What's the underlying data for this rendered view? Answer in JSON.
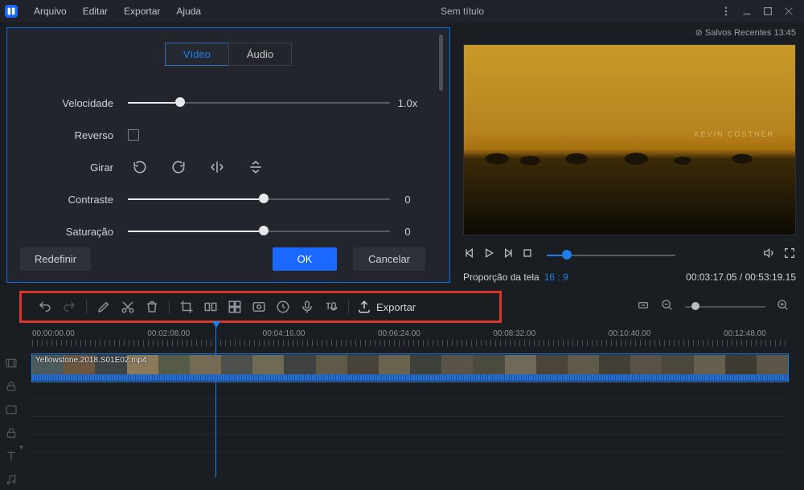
{
  "menu": {
    "file": "Arquivo",
    "edit": "Editar",
    "export": "Exportar",
    "help": "Ajuda"
  },
  "title": "Sem título",
  "save_status": "⊘ Salvos Recentes 13:45",
  "tabs": {
    "video": "Vídeo",
    "audio": "Áudio"
  },
  "props": {
    "speed_label": "Velocidade",
    "speed_value": "1.0x",
    "reverse_label": "Reverso",
    "rotate_label": "Girar",
    "contrast_label": "Contraste",
    "contrast_value": "0",
    "saturation_label": "Saturação",
    "saturation_value": "0"
  },
  "buttons": {
    "reset": "Redefinir",
    "ok": "OK",
    "cancel": "Cancelar"
  },
  "preview_credit": "KEVIN COSTNER",
  "aspect": {
    "label": "Proporção da tela",
    "value": "16 : 9"
  },
  "time": {
    "current": "00:03:17.05",
    "sep": " / ",
    "total": "00:53:19.15"
  },
  "toolbar_export": "Exportar",
  "ruler": [
    "00:00:00.00",
    "00:02:08.00",
    "00:04:16.00",
    "00:06:24.00",
    "00:08:32.00",
    "00:10:40.00",
    "00:12:48.00"
  ],
  "clip_name": "Yellowstone.2018.S01E02.mp4"
}
